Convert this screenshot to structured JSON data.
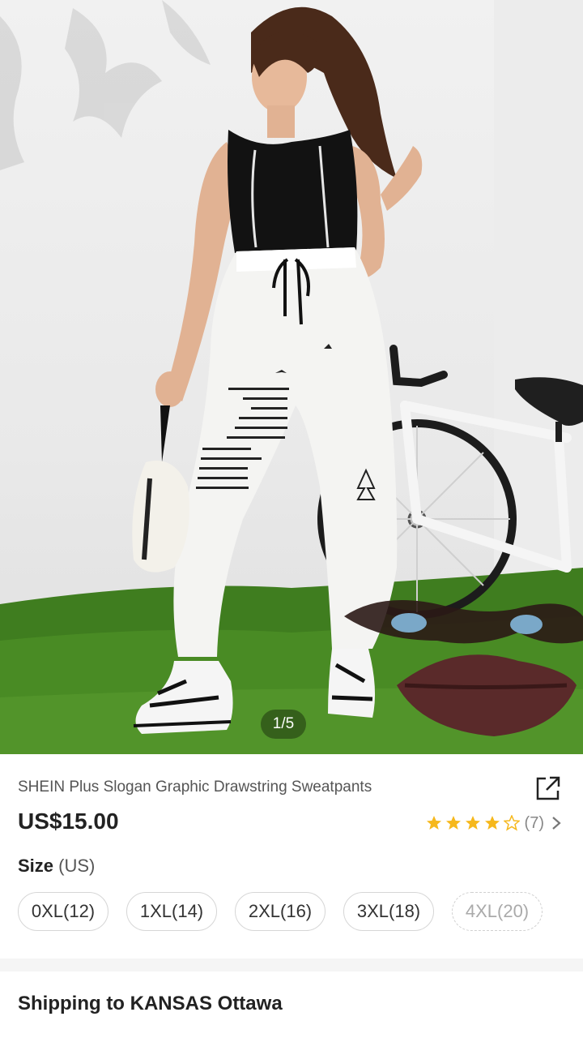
{
  "gallery": {
    "page_indicator": "1/5",
    "current_page": 1,
    "total_pages": 5
  },
  "product": {
    "title": "SHEIN Plus Slogan Graphic Drawstring Sweatpants",
    "price": "US$15.00",
    "rating": {
      "stars": 4,
      "max_stars": 5,
      "count_label": "(7)",
      "star_color": "#f6b81c"
    }
  },
  "size": {
    "label": "Size",
    "unit": "(US)",
    "options": [
      {
        "label": "0XL(12)",
        "available": true
      },
      {
        "label": "1XL(14)",
        "available": true
      },
      {
        "label": "2XL(16)",
        "available": true
      },
      {
        "label": "3XL(18)",
        "available": true
      },
      {
        "label": "4XL(20)",
        "available": false
      }
    ]
  },
  "shipping": {
    "title": "Shipping to KANSAS Ottawa"
  },
  "icons": {
    "share": "share-icon",
    "chevron": "chevron-right-icon",
    "star": "star-icon"
  }
}
